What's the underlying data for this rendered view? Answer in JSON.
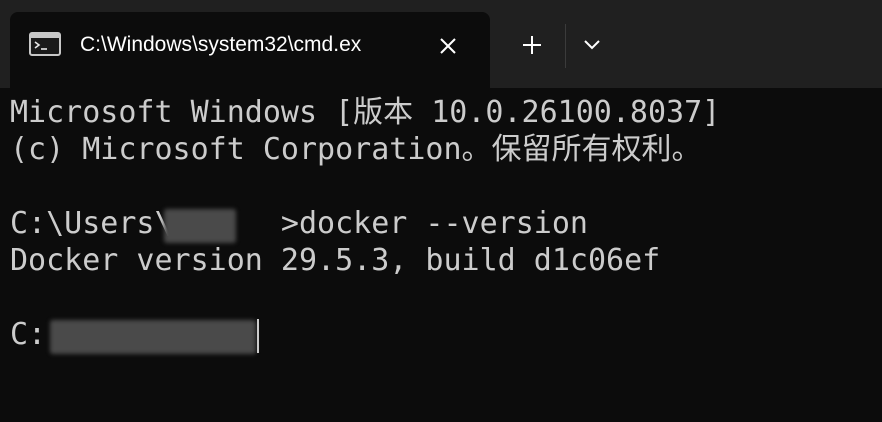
{
  "tab": {
    "icon": "cmd-icon",
    "title": "C:\\Windows\\system32\\cmd.ex"
  },
  "titlebar": {
    "close_icon": "close-icon",
    "new_tab_icon": "plus-icon",
    "dropdown_icon": "chevron-down-icon"
  },
  "terminal": {
    "line1": "Microsoft Windows [版本 10.0.26100.8037]",
    "line2": "(c) Microsoft Corporation。保留所有权利。",
    "line4": "C:\\Users\\      >docker --version",
    "line5": "Docker version 29.5.3, build d1c06ef",
    "line7": "C:"
  },
  "colors": {
    "background": "#0c0c0c",
    "titlebar": "#202020",
    "text": "#cccccc"
  }
}
